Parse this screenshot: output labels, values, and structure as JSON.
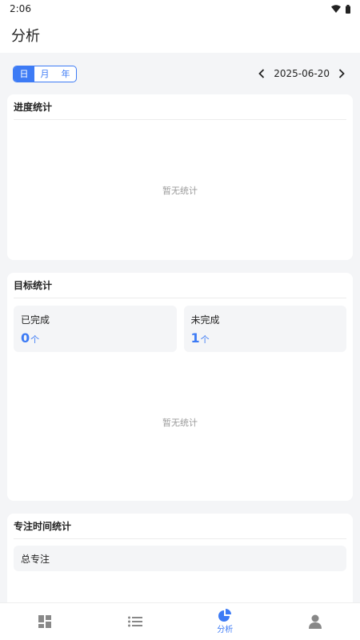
{
  "status": {
    "time": "2:06"
  },
  "header": {
    "title": "分析"
  },
  "period": {
    "options": [
      "日",
      "月",
      "年"
    ],
    "selected": "日"
  },
  "date": {
    "value": "2025-06-20"
  },
  "progress_card": {
    "title": "进度统计",
    "empty": "暂无统计"
  },
  "goal_card": {
    "title": "目标统计",
    "completed_label": "已完成",
    "completed_value": "0",
    "completed_unit": "个",
    "incomplete_label": "未完成",
    "incomplete_value": "1",
    "incomplete_unit": "个",
    "empty": "暂无统计"
  },
  "focus_card": {
    "title": "专注时间统计",
    "total_label": "总专注"
  },
  "tabs": [
    {
      "icon": "dashboard-icon",
      "label": ""
    },
    {
      "icon": "list-icon",
      "label": ""
    },
    {
      "icon": "pie-chart-icon",
      "label": "分析"
    },
    {
      "icon": "user-icon",
      "label": ""
    }
  ],
  "colors": {
    "accent": "#3d7bf5",
    "background": "#f4f5f7",
    "icon_gray": "#888888"
  }
}
